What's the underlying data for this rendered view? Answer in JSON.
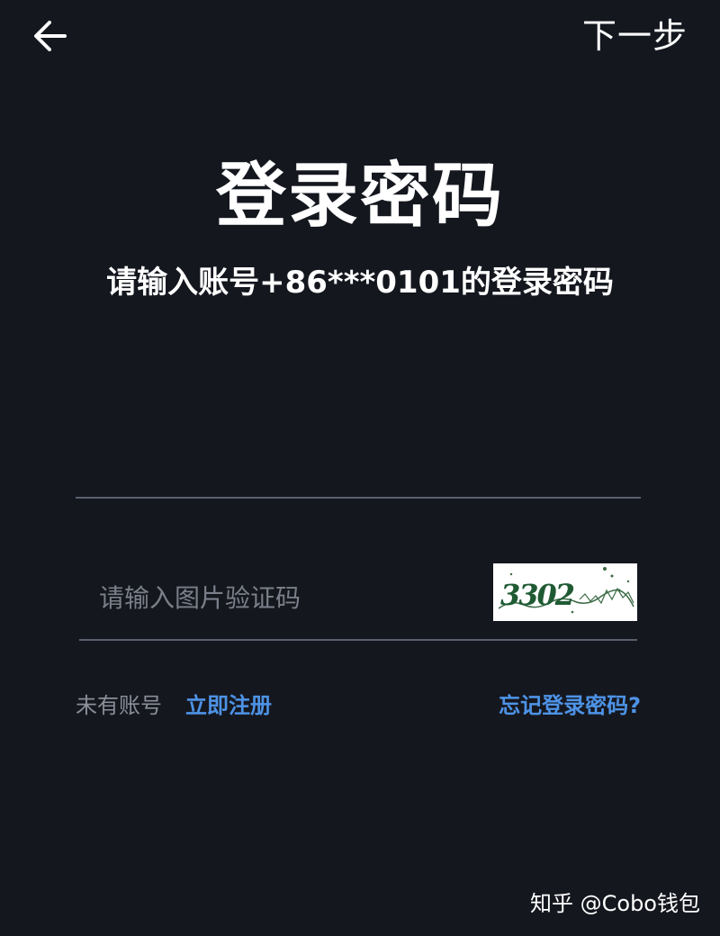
{
  "header": {
    "back_icon": "arrow-left-icon",
    "next_label": "下一步"
  },
  "main": {
    "title": "登录密码",
    "subtitle": "请输入账号+86***0101的登录密码",
    "password": {
      "value": "",
      "placeholder": ""
    },
    "captcha": {
      "placeholder": "请输入图片验证码",
      "value": "",
      "image_text": "3302"
    }
  },
  "footer_links": {
    "no_account": "未有账号",
    "register": "立即注册",
    "forgot": "忘记登录密码?"
  },
  "watermark": "知乎 @Cobo钱包",
  "colors": {
    "background": "#15171f",
    "accent": "#4d93e6",
    "divider": "#5b606d",
    "muted_text": "#8a8e98"
  }
}
